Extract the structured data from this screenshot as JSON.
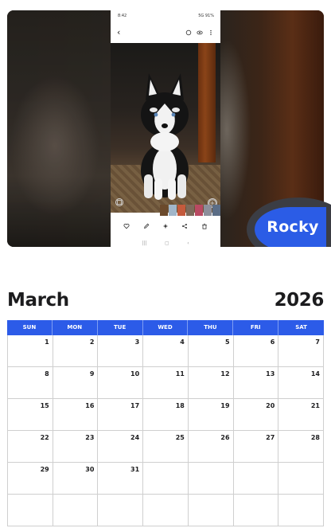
{
  "photo": {
    "phone": {
      "status_time": "8:42",
      "status_right": "5G 91%"
    },
    "pet_name": "Rocky"
  },
  "calendar": {
    "month": "March",
    "year": "2026",
    "days_of_week": [
      "SUN",
      "MON",
      "TUE",
      "WED",
      "THU",
      "FRI",
      "SAT"
    ],
    "weeks": [
      [
        "1",
        "2",
        "3",
        "4",
        "5",
        "6",
        "7"
      ],
      [
        "8",
        "9",
        "10",
        "11",
        "12",
        "13",
        "14"
      ],
      [
        "15",
        "16",
        "17",
        "18",
        "19",
        "20",
        "21"
      ],
      [
        "22",
        "23",
        "24",
        "25",
        "26",
        "27",
        "28"
      ],
      [
        "29",
        "30",
        "31",
        "",
        "",
        "",
        ""
      ],
      [
        "",
        "",
        "",
        "",
        "",
        "",
        ""
      ]
    ]
  },
  "colors": {
    "accent_blue": "#2c5be8",
    "badge_blue": "#2b5ce6",
    "text_dark": "#1c1c1e"
  }
}
